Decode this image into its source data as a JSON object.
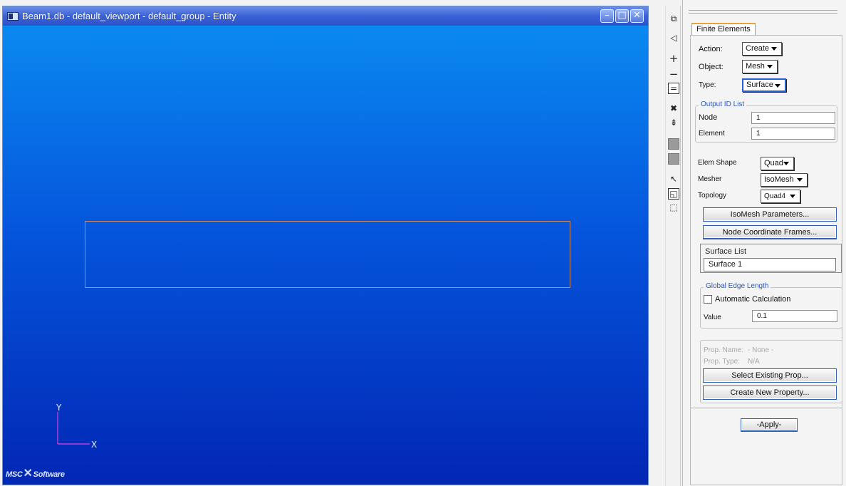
{
  "window": {
    "title": "Beam1.db - default_viewport - default_group - Entity",
    "minimize_glyph": "–",
    "maximize_glyph": "□",
    "close_glyph": "✕"
  },
  "viewport": {
    "gradient_top": "#0a89f0",
    "gradient_bottom": "#0227b4",
    "geometry_color": "#c8906a",
    "axis_y_label": "Y",
    "axis_x_label": "X",
    "brand_left": "MSC",
    "brand_right": "Software"
  },
  "toolbar": {
    "icons": [
      "view-corner-icon",
      "curve-select-icon",
      "zoom-in-icon",
      "zoom-out-icon",
      "equal-icon",
      "cross-icon",
      "pick-filter-icon",
      "gray-square-icon",
      "gray-square-icon",
      "select-arrow-icon",
      "frame-select-icon",
      "cube-select-icon"
    ]
  },
  "panel": {
    "tab_label": "Finite Elements",
    "action_label": "Action:",
    "action_value": "Create",
    "object_label": "Object:",
    "object_value": "Mesh",
    "type_label": "Type:",
    "type_value": "Surface",
    "output_group_title": "Output ID List",
    "node_label": "Node",
    "node_value": "1",
    "element_label": "Element",
    "element_value": "1",
    "elem_shape_label": "Elem Shape",
    "elem_shape_value": "Quad",
    "mesher_label": "Mesher",
    "mesher_value": "IsoMesh",
    "topology_label": "Topology",
    "topology_value": "Quad4",
    "isomesh_params_button": "IsoMesh Parameters...",
    "node_coord_button": "Node Coordinate Frames...",
    "surface_list_label": "Surface List",
    "surface_list_value": "Surface 1",
    "edge_group_title": "Global Edge Length",
    "auto_calc_label": "Automatic Calculation",
    "value_label": "Value",
    "value_value": "0.1",
    "prop_name_label": "Prop. Name:",
    "prop_name_value": "- None -",
    "prop_type_label": "Prop. Type:",
    "prop_type_value": "N/A",
    "select_prop_button": "Select Existing Prop...",
    "create_prop_button": "Create New Property...",
    "apply_button": "-Apply-"
  }
}
